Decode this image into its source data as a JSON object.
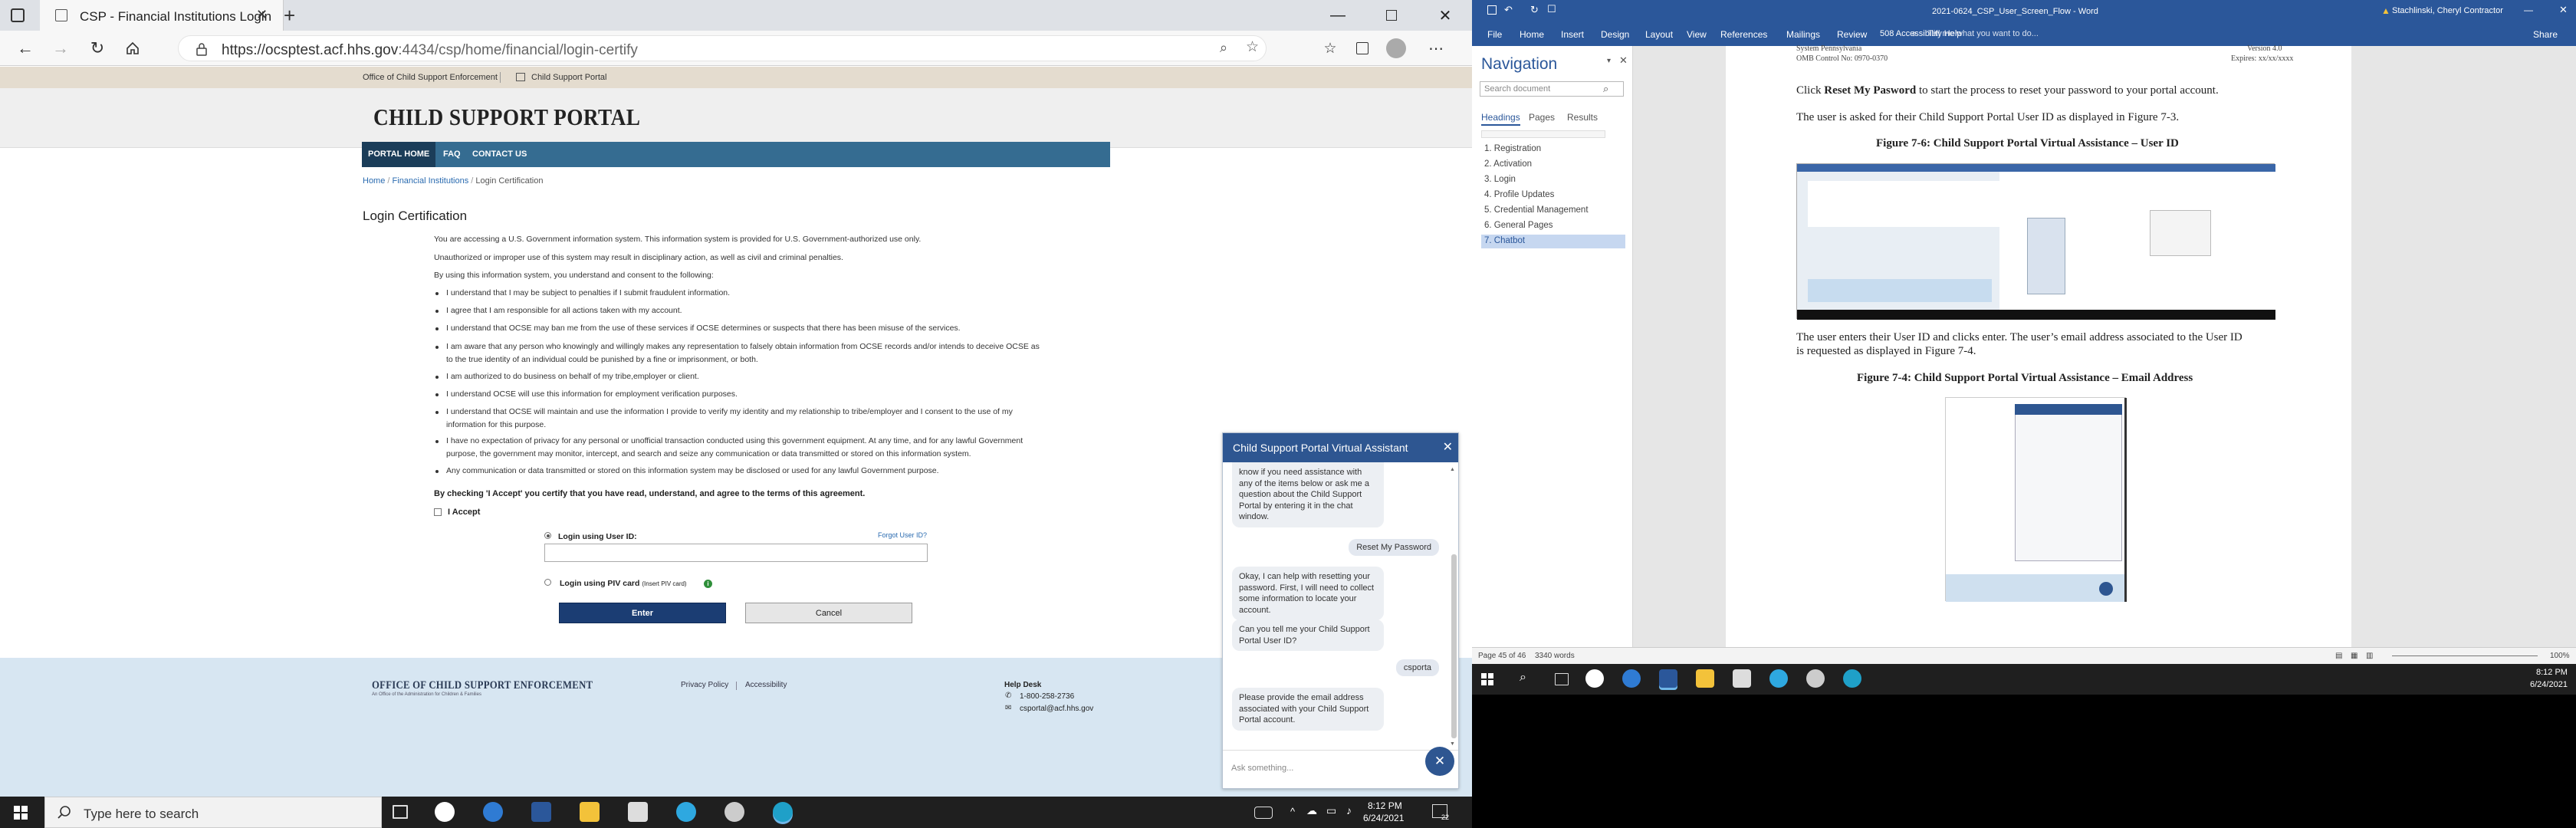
{
  "browser": {
    "tab_title": "CSP - Financial Institutions Login",
    "url_host": "https://ocsptest.acf.hhs.gov",
    "url_path": ":4434/csp/home/financial/login-certify"
  },
  "site": {
    "top_links": [
      "Office of Child Support Enforcement",
      "Child Support Portal"
    ],
    "portal_title": "CHILD SUPPORT PORTAL",
    "nav": [
      "PORTAL HOME",
      "FAQ",
      "CONTACT US"
    ],
    "breadcrumb": [
      "Home",
      "Financial Institutions",
      "Login Certification"
    ],
    "page_title": "Login Certification",
    "intro": [
      "You are accessing a U.S. Government information system. This information system is provided for U.S. Government-authorized use only.",
      "Unauthorized or improper use of this system may result in disciplinary action, as well as civil and criminal penalties.",
      "By using this information system, you understand and consent to the following:"
    ],
    "bullets": [
      "I understand that I may be subject to penalties if I submit fraudulent information.",
      "I agree that I am responsible for all actions taken with my account.",
      "I understand that OCSE may ban me from the use of these services if OCSE determines or suspects that there has been misuse of the services.",
      "I am aware that any person who knowingly and willingly makes any representation to falsely obtain information from OCSE records and/or intends to deceive OCSE as to the true identity of an individual could be punished by a fine or imprisonment, or both.",
      "I am authorized to do business on behalf of my tribe,employer or client.",
      "I understand OCSE will use this information for employment verification purposes.",
      "I understand that OCSE will maintain and use the information I provide to verify my identity and my relationship to tribe/employer and I consent to the use of my information for this purpose.",
      "I have no expectation of privacy for any personal or unofficial transaction conducted using this government equipment. At any time, and for any lawful Government purpose, the government may monitor, intercept, and search and seize any communication or data transmitted or stored on this information system.",
      "Any communication or data transmitted or stored on this information system may be disclosed or used for any lawful Government purpose."
    ],
    "agree_text": "By checking 'I Accept' you certify that you have read, understand, and agree to the terms of this agreement.",
    "accept_label": "I Accept",
    "userid_label": "Login using User ID:",
    "forgot_link": "Forgot User ID?",
    "piv_label": "Login using PIV card",
    "piv_small": "(Insert PIV card)",
    "enter_label": "Enter",
    "cancel_label": "Cancel",
    "footer": {
      "org": "OFFICE OF CHILD SUPPORT ENFORCEMENT",
      "org_sub": "An Office of the Administration for Children & Families",
      "privacy": "Privacy Policy",
      "accessibility": "Accessibility",
      "help_title": "Help Desk",
      "phone": "1-800-258-2736",
      "email": "csportal@acf.hhs.gov"
    }
  },
  "chat": {
    "title": "Child Support Portal Virtual Assistant",
    "messages": [
      {
        "from": "bot",
        "text": "know if you need assistance with any of the items below or ask me a question about the Child Support Portal by entering it in the chat window."
      },
      {
        "from": "user",
        "text": "Reset My Password"
      },
      {
        "from": "bot",
        "text": "Okay, I can help with resetting your password. First, I will need to collect some information to locate your account."
      },
      {
        "from": "bot",
        "text": "Can you tell me your Child Support Portal User ID?"
      },
      {
        "from": "user",
        "text": "csporta"
      },
      {
        "from": "bot",
        "text": "Please provide the email address associated with your Child Support Portal account."
      }
    ],
    "placeholder": "Ask something..."
  },
  "taskbar_left": {
    "search_placeholder": "Type here to search",
    "time": "8:12 PM",
    "date": "6/24/2021",
    "notif_count": "22"
  },
  "word": {
    "title": "2021-0624_CSP_User_Screen_Flow - Word",
    "user": "Stachlinski, Cheryl   Contractor",
    "menu": [
      "File",
      "Home",
      "Insert",
      "Design",
      "Layout",
      "View",
      "References",
      "Mailings",
      "Review",
      "508 Accessibility Help"
    ],
    "tell_me": "Tell me what you want to do...",
    "share": "Share",
    "nav_title": "Navigation",
    "nav_search": "Search document",
    "nav_tabs": [
      "Headings",
      "Pages",
      "Results"
    ],
    "headings": [
      "1. Registration",
      "2. Activation",
      "3. Login",
      "4. Profile Updates",
      "5. Credential Management",
      "6. General Pages",
      "7. Chatbot"
    ],
    "doc_header_left": "System Pennsylvania",
    "doc_header_left2": "OMB Control No: 0970-0370",
    "doc_header_right": "Version 4.0",
    "doc_header_right2": "Expires: xx/xx/xxxx",
    "para1_pre": "Click ",
    "para1_bold": "Reset My Pasword",
    "para1_post": " to start the process to reset your password to your portal account.",
    "para2": "The user is asked for their Child Support Portal User ID as displayed in Figure 7-3.",
    "fig1_caption": "Figure 7-6: Child Support Portal Virtual Assistance – User ID",
    "para3a": "The user enters their User ID and clicks enter. The user’s email address associated to the User ID",
    "para3b": "is requested as displayed in Figure 7-4.",
    "fig2_caption": "Figure 7-4: Child Support Portal Virtual Assistance – Email Address",
    "status_page": "Page 45 of 46",
    "status_words": "3340 words",
    "zoom": "100%"
  },
  "taskbar_right": {
    "time": "8:12 PM",
    "date": "6/24/2021"
  }
}
